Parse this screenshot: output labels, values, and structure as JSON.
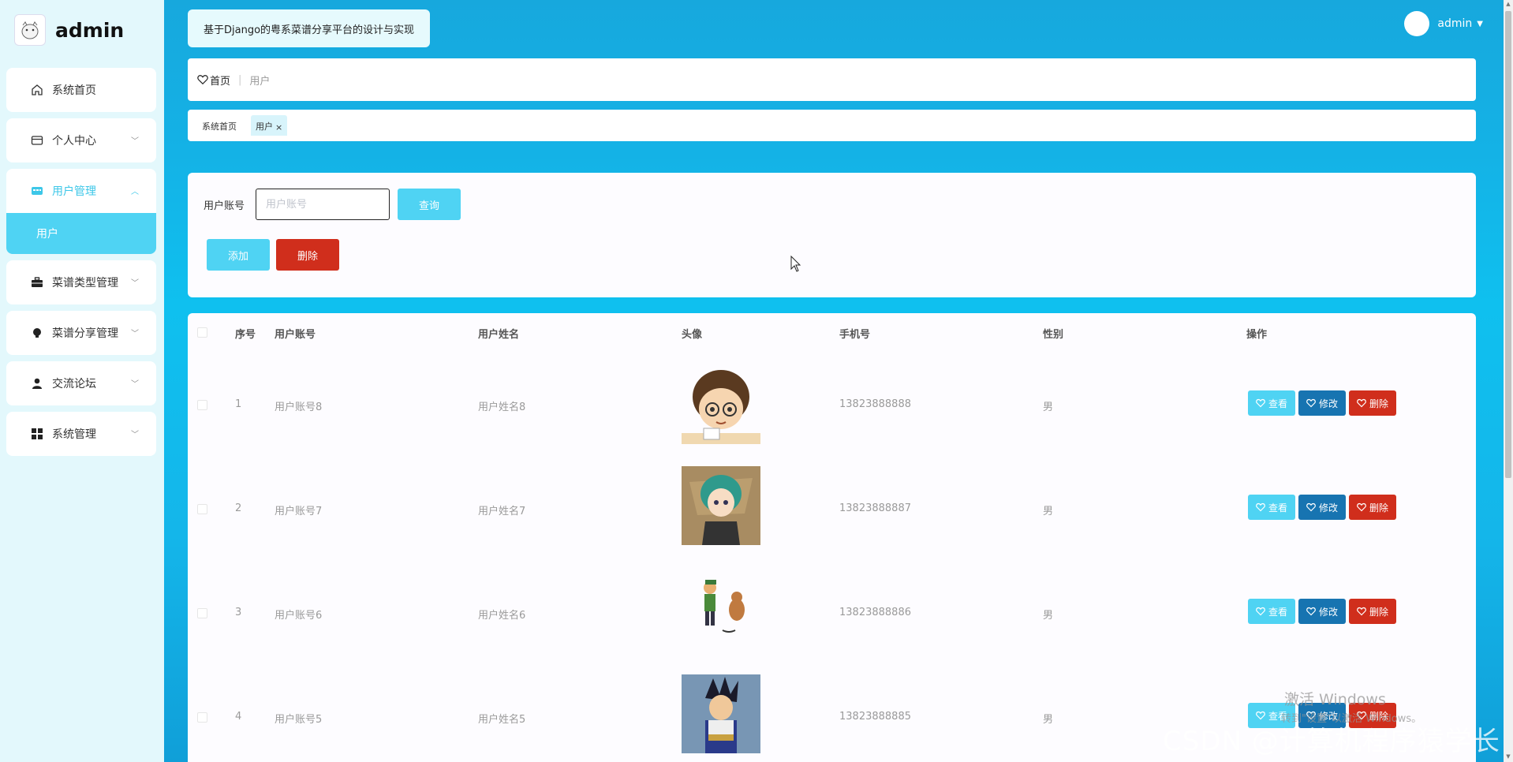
{
  "app": {
    "brand": "admin",
    "title": "基于Django的粤系菜谱分享平台的设计与实现",
    "user": "admin"
  },
  "sidebar": {
    "items": [
      {
        "label": "系统首页",
        "icon": "home-icon"
      },
      {
        "label": "个人中心",
        "icon": "profile-card-icon"
      },
      {
        "label": "用户管理",
        "icon": "users-manage-icon",
        "sub": "用户"
      },
      {
        "label": "菜谱类型管理",
        "icon": "briefcase-icon"
      },
      {
        "label": "菜谱分享管理",
        "icon": "bulb-icon"
      },
      {
        "label": "交流论坛",
        "icon": "person-icon"
      },
      {
        "label": "系统管理",
        "icon": "grid-icon"
      }
    ]
  },
  "breadcrumb": {
    "home": "首页",
    "sep": "|",
    "current": "用户"
  },
  "tags": {
    "home": "系统首页",
    "active": "用户",
    "close": "×"
  },
  "search": {
    "label": "用户账号",
    "placeholder": "用户账号",
    "value": ""
  },
  "buttons": {
    "query": "查询",
    "add": "添加",
    "delete": "删除"
  },
  "table": {
    "headers": [
      "序号",
      "用户账号",
      "用户姓名",
      "头像",
      "手机号",
      "性别",
      "操作"
    ],
    "rows": [
      {
        "index": "1",
        "account": "用户账号8",
        "name": "用户姓名8",
        "phone": "13823888888",
        "gender": "男"
      },
      {
        "index": "2",
        "account": "用户账号7",
        "name": "用户姓名7",
        "phone": "13823888887",
        "gender": "男"
      },
      {
        "index": "3",
        "account": "用户账号6",
        "name": "用户姓名6",
        "phone": "13823888886",
        "gender": "男"
      },
      {
        "index": "4",
        "account": "用户账号5",
        "name": "用户姓名5",
        "phone": "13823888885",
        "gender": "男"
      }
    ],
    "actions": {
      "view": "查看",
      "edit": "修改",
      "delete": "删除"
    }
  },
  "watermarks": {
    "activate": "激活 Windows",
    "activate_sub": "转到\"设置\"以激活 Windows。",
    "csdn": "CSDN @计算机程序猿学长"
  },
  "colors": {
    "accent": "#4fd3f3",
    "edit": "#1774b1",
    "danger": "#d02e1c",
    "sidebar": "#e3f8fc"
  }
}
